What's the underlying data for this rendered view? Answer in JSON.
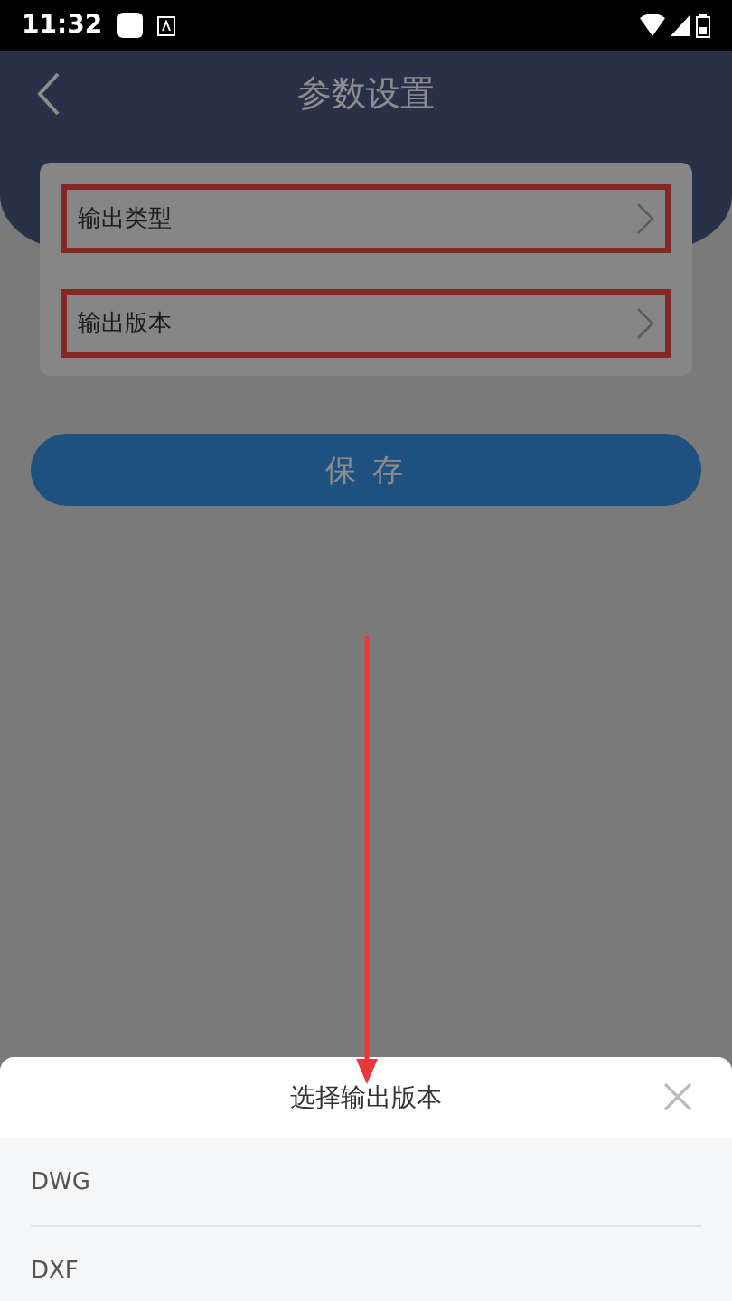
{
  "status_bar": {
    "time": "11:32"
  },
  "header": {
    "title": "参数设置"
  },
  "settings": [
    {
      "label": "输出类型",
      "highlighted": true
    },
    {
      "label": "输出版本",
      "highlighted": true
    }
  ],
  "save_button": {
    "label": "保 存"
  },
  "sheet": {
    "title": "选择输出版本",
    "options": [
      "DWG",
      "DXF"
    ]
  }
}
